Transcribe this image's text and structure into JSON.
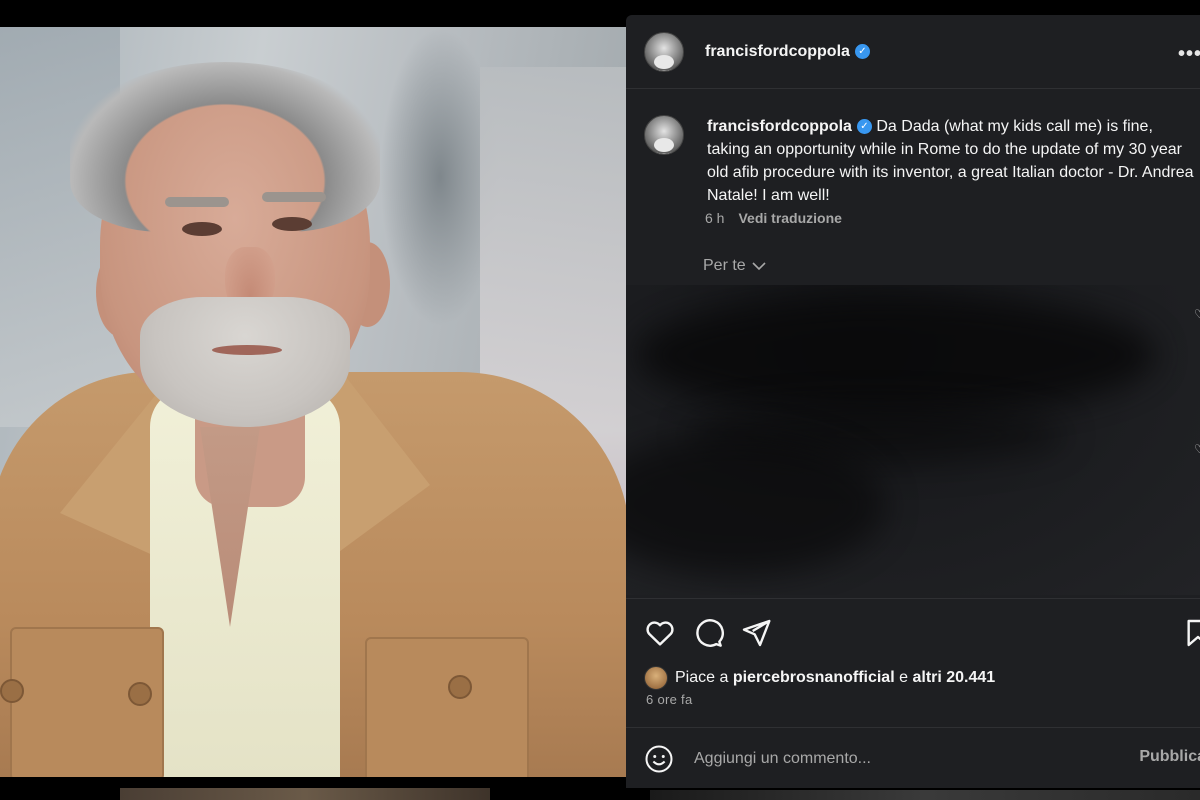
{
  "post": {
    "username": "francisfordcoppola",
    "verified_mark": "✓",
    "more_icon": "more-horizontal-icon",
    "caption": {
      "username": "francisfordcoppola",
      "text": "Da Dada (what my kids call me) is fine, taking an opportunity while in Rome to do the update of my 30 year old afib procedure with its inventor, a great Italian doctor - Dr. Andrea Natale! I am well!"
    },
    "caption_time": "6 h",
    "translate_label": "Vedi traduzione",
    "for_you_label": "Per te",
    "likes": {
      "prefix": "Piace a ",
      "user": "piercebrosnanofficial",
      "middle": " e ",
      "others": "altri 20.441"
    },
    "time_ago": "6 ore fa",
    "comment": {
      "placeholder": "Aggiungi un commento...",
      "publish_label": "Pubblica"
    }
  },
  "colors": {
    "panel_bg": "#1e1f22",
    "text_primary": "#f5f5f5",
    "text_secondary": "#a8a8a8",
    "verified_blue": "#3897f0"
  }
}
